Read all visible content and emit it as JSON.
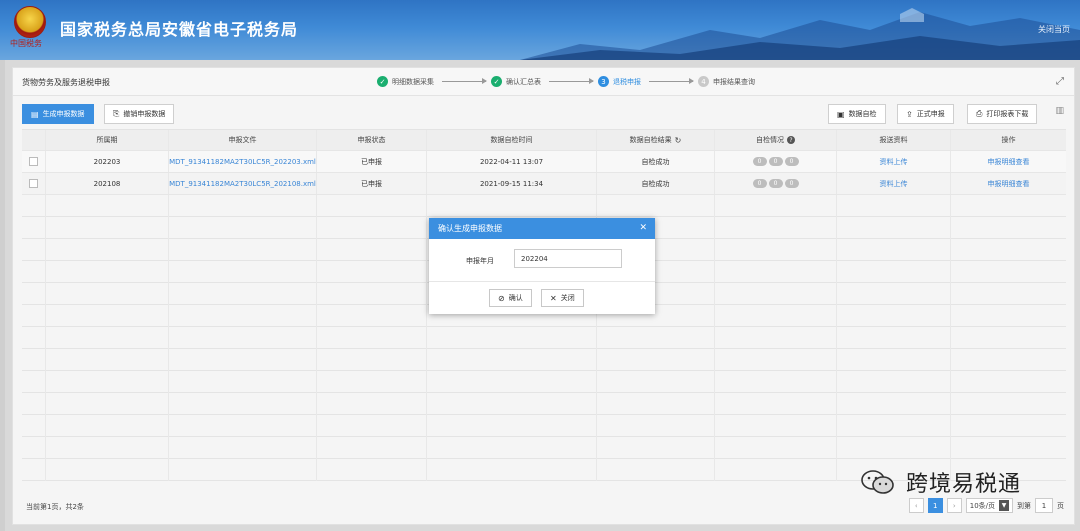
{
  "header": {
    "title": "国家税务总局安徽省电子税务局",
    "emblem_text": "中国税务",
    "top_links": [
      "",
      "关闭当页"
    ]
  },
  "page": {
    "title": "货物劳务及服务退税申报",
    "steps": [
      {
        "num": "✓",
        "label": "明细数据采集",
        "state": "done"
      },
      {
        "num": "✓",
        "label": "确认汇总表",
        "state": "done"
      },
      {
        "num": "3",
        "label": "退税申报",
        "state": "current"
      },
      {
        "num": "4",
        "label": "申报结果查询",
        "state": "todo"
      }
    ]
  },
  "toolbar": {
    "generate_label": "生成申报数据",
    "revoke_label": "撤销申报数据",
    "check_label": "数据自检",
    "formal_label": "正式申报",
    "print_label": "打印报表下载"
  },
  "table": {
    "headers": [
      "",
      "所属期",
      "申报文件",
      "申报状态",
      "数据自检时间",
      "数据自检结果",
      "自检情况",
      "报送资料",
      "操作"
    ],
    "rows": [
      {
        "period": "202203",
        "file": "MDT_91341182MA2T30LC5R_202203.xml",
        "status": "已申报",
        "time": "2022-04-11 13:07",
        "result": "自检成功",
        "pills": [
          "0",
          "0",
          "0"
        ],
        "upload": "资料上传",
        "action": "申报明细查看"
      },
      {
        "period": "202108",
        "file": "MDT_91341182MA2T30LC5R_202108.xml",
        "status": "已申报",
        "time": "2021-09-15 11:34",
        "result": "自检成功",
        "pills": [
          "0",
          "0",
          "0"
        ],
        "upload": "资料上传",
        "action": "申报明细查看"
      }
    ]
  },
  "footer": {
    "summary": "当前第1页，共2条",
    "current_page": "1",
    "page_size": "10条/页",
    "goto_label": "到第",
    "goto_value": "1",
    "page_suffix": "页"
  },
  "modal": {
    "title": "确认生成申报数据",
    "field_label": "申报年月",
    "field_value": "202204",
    "confirm_label": "确认",
    "close_label": "关闭"
  },
  "watermark": {
    "text": "跨境易税通"
  },
  "colors": {
    "primary": "#3b8fe0",
    "success": "#1aae6f",
    "link": "#3a86d6"
  }
}
